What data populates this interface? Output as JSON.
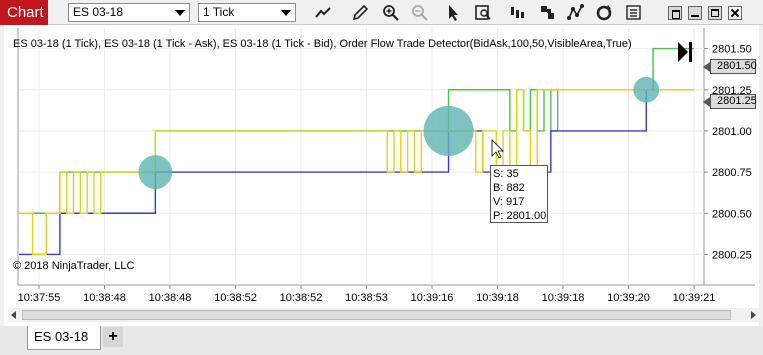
{
  "toolbar": {
    "chart_label": "Chart",
    "instrument": "ES 03-18",
    "interval": "1 Tick",
    "tools": [
      "line-chart-icon",
      "pencil-icon",
      "zoom-in-icon",
      "zoom-out-icon",
      "cursor-icon",
      "data-box-icon",
      "bar-type-icon",
      "strategy-icon",
      "drawing-tools-icon",
      "refresh-icon",
      "properties-icon"
    ]
  },
  "window": {
    "buttons": [
      "restore-icon",
      "minimize-icon",
      "maximize-icon",
      "close-icon"
    ]
  },
  "chart": {
    "info_label": "ES 03-18 (1 Tick), ES 03-18 (1 Tick - Ask), ES 03-18 (1 Tick - Bid), Order Flow Trade Detector(BidAsk,100,50,VisibleArea,True)",
    "copyright": "© 2018 NinjaTrader, LLC",
    "price_tags": [
      "2801.50",
      "2801.25"
    ],
    "tooltip": {
      "lines": [
        "S: 35",
        "B: 882",
        "V: 917",
        "P: 2801.00"
      ]
    }
  },
  "chart_data": {
    "type": "line",
    "x_tick_labels": [
      "10:37:55",
      "10:38:48",
      "10:38:48",
      "10:38:52",
      "10:38:52",
      "10:38:53",
      "10:39:16",
      "10:39:18",
      "10:39:18",
      "10:39:20",
      "10:39:21"
    ],
    "y_tick_labels": [
      "2801.50",
      "2801.25",
      "2801.00",
      "2800.75",
      "2800.50",
      "2800.25"
    ],
    "ylim": [
      2800.125,
      2801.625
    ],
    "x_count": 100,
    "colors": {
      "last": "#e3d21c",
      "ask": "#4ec24e",
      "bid": "#3a3acf",
      "bubble": "#5fb3b3"
    },
    "series": [
      {
        "name": "ES 03-18 (1 Tick - Ask)",
        "steps": [
          [
            0,
            2800.5
          ],
          [
            6,
            2800.75
          ],
          [
            20,
            2801.0
          ],
          [
            63,
            2801.25
          ],
          [
            72,
            2801.0
          ],
          [
            73,
            2801.25
          ],
          [
            74,
            2801.0
          ],
          [
            75,
            2801.25
          ],
          [
            76,
            2801.0
          ],
          [
            77,
            2801.25
          ],
          [
            78,
            2801.0
          ],
          [
            79,
            2801.25
          ],
          [
            93,
            2801.5
          ],
          [
            99,
            2801.5
          ]
        ]
      },
      {
        "name": "ES 03-18 (1 Tick - Bid)",
        "steps": [
          [
            0,
            2800.25
          ],
          [
            6,
            2800.5
          ],
          [
            20,
            2800.75
          ],
          [
            63,
            2801.0
          ],
          [
            68,
            2800.75
          ],
          [
            70,
            2800.75
          ],
          [
            72,
            2800.75
          ],
          [
            74,
            2800.75
          ],
          [
            78,
            2801.0
          ],
          [
            82,
            2801.0
          ],
          [
            92,
            2801.25
          ],
          [
            99,
            2801.25
          ]
        ]
      },
      {
        "name": "ES 03-18 (1 Tick)",
        "steps": [
          [
            0,
            2800.5
          ],
          [
            2,
            2800.25
          ],
          [
            4,
            2800.5
          ],
          [
            6,
            2800.75
          ],
          [
            7,
            2800.5
          ],
          [
            8,
            2800.75
          ],
          [
            9,
            2800.5
          ],
          [
            10,
            2800.75
          ],
          [
            11,
            2800.5
          ],
          [
            12,
            2800.75
          ],
          [
            20,
            2801.0
          ],
          [
            54,
            2800.75
          ],
          [
            55,
            2801.0
          ],
          [
            56,
            2800.75
          ],
          [
            57,
            2801.0
          ],
          [
            58,
            2800.75
          ],
          [
            59,
            2801.0
          ],
          [
            63,
            2801.0
          ],
          [
            67,
            2800.75
          ],
          [
            68,
            2801.0
          ],
          [
            70,
            2800.75
          ],
          [
            71,
            2801.0
          ],
          [
            72,
            2800.75
          ],
          [
            73,
            2801.25
          ],
          [
            74,
            2801.0
          ],
          [
            75,
            2800.75
          ],
          [
            76,
            2801.25
          ],
          [
            92,
            2801.25
          ],
          [
            99,
            2801.25
          ]
        ]
      }
    ],
    "bubbles": [
      {
        "x": 20,
        "y": 2800.75,
        "volume": 300
      },
      {
        "x": 63,
        "y": 2801.0,
        "volume": 917
      },
      {
        "x": 92,
        "y": 2801.25,
        "volume": 120
      }
    ]
  },
  "tabs": {
    "active": "ES 03-18",
    "add": "+"
  }
}
